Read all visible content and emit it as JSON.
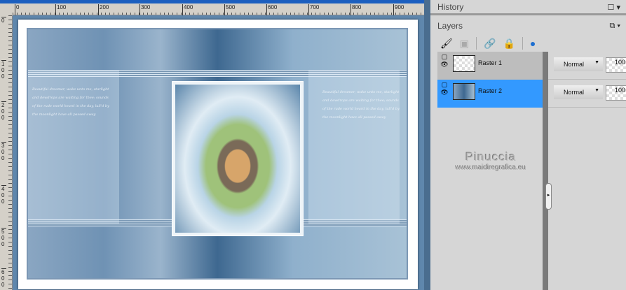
{
  "ruler": {
    "h": [
      "0",
      "100",
      "200",
      "300",
      "400",
      "500",
      "600",
      "700",
      "800",
      "900"
    ],
    "v": [
      "0",
      "100",
      "200",
      "300",
      "400",
      "500",
      "600"
    ]
  },
  "panels": {
    "history": "History",
    "layers": "Layers"
  },
  "layers": [
    {
      "name": "Raster 1",
      "blend": "Normal",
      "opacity": "100",
      "selected": false
    },
    {
      "name": "Raster 2",
      "blend": "Normal",
      "opacity": "100",
      "selected": true
    }
  ],
  "watermark": {
    "name": "Pinuccia",
    "url": "www.maidiregrafica.eu"
  },
  "script_text": "Beautiful dreamer, wake unto me, starlight and dewdrops are waiting for thee; sounds of the rude world heard in the day, lull'd by the moonlight have all passed away"
}
